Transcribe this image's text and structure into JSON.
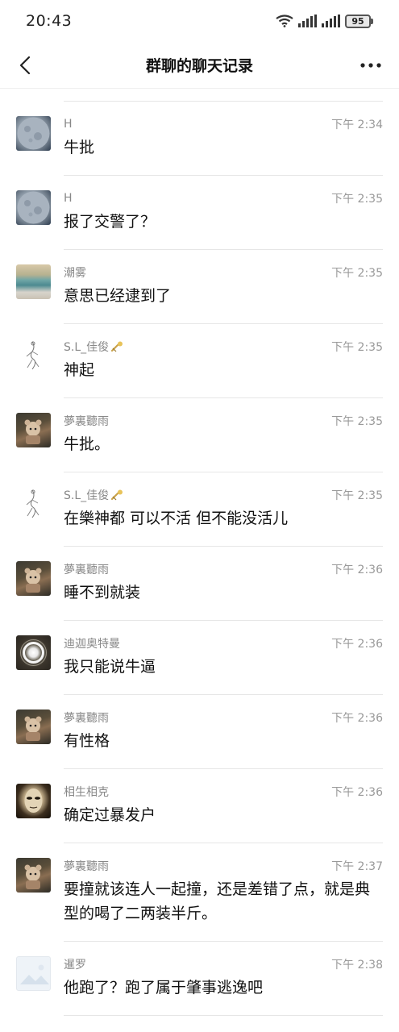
{
  "status": {
    "time": "20:43",
    "battery": "95"
  },
  "nav": {
    "title": "群聊的聊天记录"
  },
  "messages": [
    {
      "sender": "H",
      "time": "下午 2:34",
      "text": "牛批",
      "avatar": "moon"
    },
    {
      "sender": "H",
      "time": "下午 2:35",
      "text": "报了交警了？",
      "avatar": "moon"
    },
    {
      "sender": "潮雾",
      "time": "下午 2:35",
      "text": "意思已经逮到了",
      "avatar": "sea"
    },
    {
      "sender": "S.L_佳俊",
      "time": "下午 2:35",
      "text": "神起",
      "avatar": "sketch",
      "badge": true
    },
    {
      "sender": "夢裏聽雨",
      "time": "下午 2:35",
      "text": "牛批。",
      "avatar": "toy"
    },
    {
      "sender": "S.L_佳俊",
      "time": "下午 2:35",
      "text": "在樂神都 可以不活 但不能没活儿",
      "avatar": "sketch",
      "badge": true
    },
    {
      "sender": "夢裏聽雨",
      "time": "下午 2:36",
      "text": "睡不到就装",
      "avatar": "toy"
    },
    {
      "sender": "迪迦奥特曼",
      "time": "下午 2:36",
      "text": "我只能说牛逼",
      "avatar": "ring"
    },
    {
      "sender": "夢裏聽雨",
      "time": "下午 2:36",
      "text": "有性格",
      "avatar": "toy"
    },
    {
      "sender": "相生相克",
      "time": "下午 2:36",
      "text": "确定过暴发户",
      "avatar": "mask"
    },
    {
      "sender": "夢裏聽雨",
      "time": "下午 2:37",
      "text": "要撞就该连人一起撞，还是差错了点，就是典型的喝了二两装半斤。",
      "avatar": "toy"
    },
    {
      "sender": "暹罗",
      "time": "下午 2:38",
      "text": "他跑了？跑了属于肇事逃逸吧",
      "avatar": "image"
    }
  ]
}
